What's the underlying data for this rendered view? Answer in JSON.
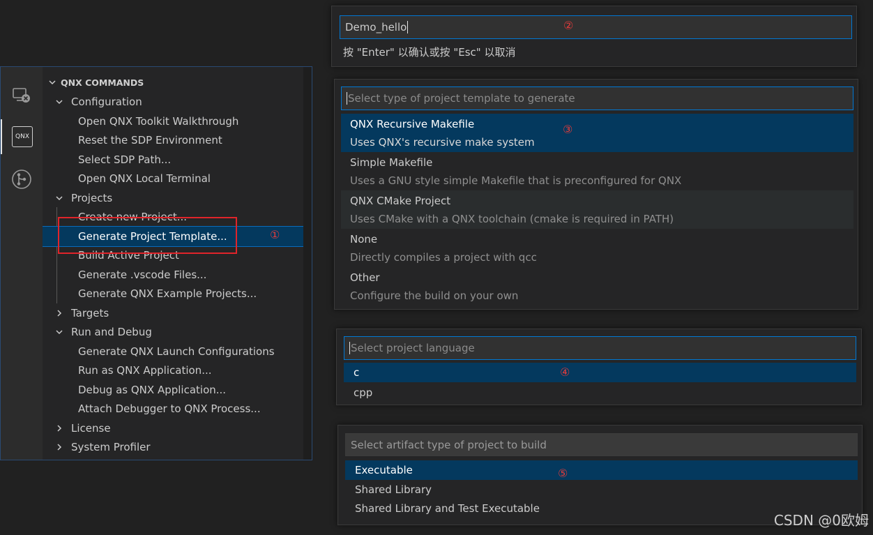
{
  "explorer": {
    "header": "QNX COMMANDS",
    "configuration": {
      "label": "Configuration",
      "items": [
        "Open QNX Toolkit Walkthrough",
        "Reset the SDP Environment",
        "Select SDP Path...",
        "Open QNX Local Terminal"
      ]
    },
    "projects": {
      "label": "Projects",
      "items": [
        "Create new Project...",
        "Generate Project Template...",
        "Build Active Project",
        "Generate .vscode Files...",
        "Generate QNX Example Projects..."
      ]
    },
    "targets": {
      "label": "Targets"
    },
    "run_debug": {
      "label": "Run and Debug",
      "items": [
        "Generate QNX Launch Configurations",
        "Run as QNX Application...",
        "Debug as QNX Application...",
        "Attach Debugger to QNX Process..."
      ]
    },
    "license": {
      "label": "License"
    },
    "profiler": {
      "label": "System Profiler"
    }
  },
  "activity": {
    "remote_icon": "remote-explorer-icon",
    "qnx_label": "QNX",
    "git_icon": "source-control-icon"
  },
  "annotations": {
    "one": "①",
    "two": "②",
    "three": "③",
    "four": "④",
    "five": "⑤"
  },
  "name_prompt": {
    "value": "Demo_hello",
    "hint": "按 \"Enter\" 以确认或按 \"Esc\" 以取消"
  },
  "template_picker": {
    "placeholder": "Select type of project template to generate",
    "items": [
      {
        "label": "QNX Recursive Makefile",
        "desc": "Uses QNX's recursive make system"
      },
      {
        "label": "Simple Makefile",
        "desc": "Uses a GNU style simple Makefile that is preconfigured for QNX"
      },
      {
        "label": "QNX CMake Project",
        "desc": "Uses CMake with a QNX toolchain (cmake is required in PATH)"
      },
      {
        "label": "None",
        "desc": "Directly compiles a project with qcc"
      },
      {
        "label": "Other",
        "desc": "Configure the build on your own"
      }
    ]
  },
  "language_picker": {
    "placeholder": "Select project language",
    "items": [
      "c",
      "cpp"
    ]
  },
  "artifact_picker": {
    "placeholder": "Select artifact type of project to build",
    "items": [
      "Executable",
      "Shared Library",
      "Shared Library and Test Executable"
    ]
  },
  "watermark": "CSDN @0欧姆",
  "colors": {
    "selection": "#04395e",
    "focus_border": "#0078d4",
    "annotation_red": "#e0242a"
  }
}
